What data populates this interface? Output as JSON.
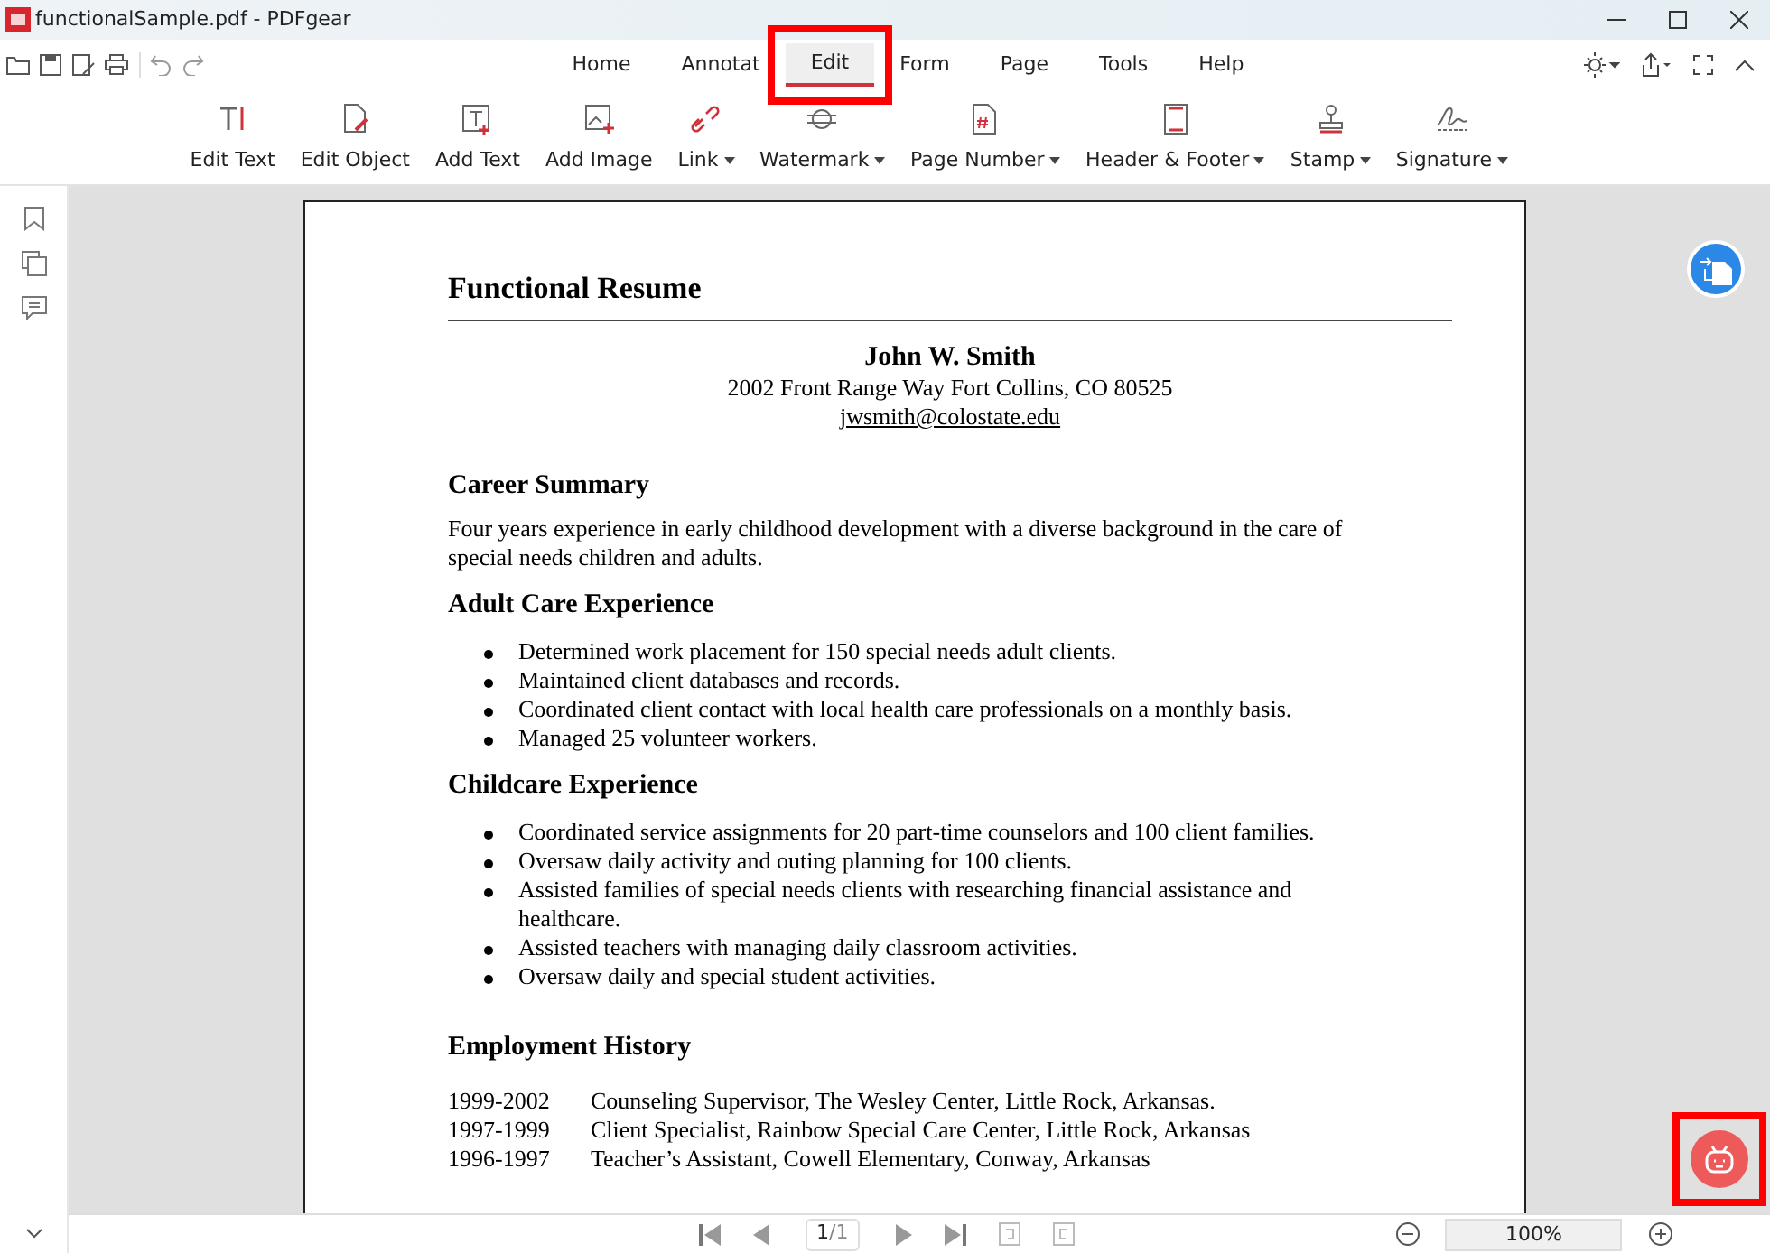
{
  "window": {
    "title": "functionalSample.pdf - PDFgear"
  },
  "menu_tabs": [
    {
      "label": "Home",
      "selected": false,
      "highlighted": false
    },
    {
      "label": "Annotat",
      "selected": false,
      "highlighted": false
    },
    {
      "label": "Edit",
      "selected": true,
      "highlighted": true
    },
    {
      "label": "Form",
      "selected": false,
      "highlighted": false
    },
    {
      "label": "Page",
      "selected": false,
      "highlighted": false
    },
    {
      "label": "Tools",
      "selected": false,
      "highlighted": false
    },
    {
      "label": "Help",
      "selected": false,
      "highlighted": false
    }
  ],
  "ribbon": [
    {
      "kind": "edit-text",
      "label": "Edit Text",
      "dropdown": false
    },
    {
      "kind": "edit-object",
      "label": "Edit Object",
      "dropdown": false
    },
    {
      "kind": "add-text",
      "label": "Add Text",
      "dropdown": false
    },
    {
      "kind": "add-image",
      "label": "Add Image",
      "dropdown": false
    },
    {
      "kind": "link",
      "label": "Link",
      "dropdown": true
    },
    {
      "kind": "watermark",
      "label": "Watermark",
      "dropdown": true
    },
    {
      "kind": "page-number",
      "label": "Page Number",
      "dropdown": true
    },
    {
      "kind": "header-footer",
      "label": "Header & Footer",
      "dropdown": true
    },
    {
      "kind": "stamp",
      "label": "Stamp",
      "dropdown": true
    },
    {
      "kind": "signature",
      "label": "Signature",
      "dropdown": true
    }
  ],
  "document": {
    "title": "Functional Resume",
    "name": "John W. Smith",
    "address": "2002 Front Range Way Fort Collins, CO 80525",
    "email": "jwsmith@colostate.edu",
    "sections": [
      {
        "kind": "paragraph",
        "heading": "Career Summary",
        "text": "Four years experience in early childhood development with a diverse background in the care of special needs children and adults."
      },
      {
        "kind": "bullets",
        "heading": "Adult Care Experience",
        "items": [
          "Determined work placement for 150 special needs adult clients.",
          "Maintained client databases and records.",
          "Coordinated client contact with local health care professionals on a monthly basis.",
          "Managed 25 volunteer workers."
        ]
      },
      {
        "kind": "bullets",
        "heading": "Childcare Experience",
        "items": [
          "Coordinated service assignments for 20 part-time counselors and 100 client families.",
          "Oversaw daily activity and outing planning for 100 clients.",
          "Assisted families of special needs clients with researching financial assistance and healthcare.",
          "Assisted teachers with managing daily classroom activities.",
          "Oversaw daily and special student activities."
        ]
      },
      {
        "kind": "history",
        "heading": "Employment History",
        "entries": [
          {
            "years": "1999-2002",
            "role": "Counseling Supervisor, The Wesley Center, Little Rock, Arkansas."
          },
          {
            "years": "1997-1999",
            "role": "Client Specialist, Rainbow Special Care Center, Little Rock, Arkansas"
          },
          {
            "years": "1996-1997",
            "role": "Teacher’s Assistant, Cowell Elementary, Conway, Arkansas"
          }
        ]
      }
    ]
  },
  "page_indicator": {
    "current": "1",
    "total": "/1"
  },
  "zoom": "100%",
  "assistant_button": {
    "highlighted": true
  }
}
